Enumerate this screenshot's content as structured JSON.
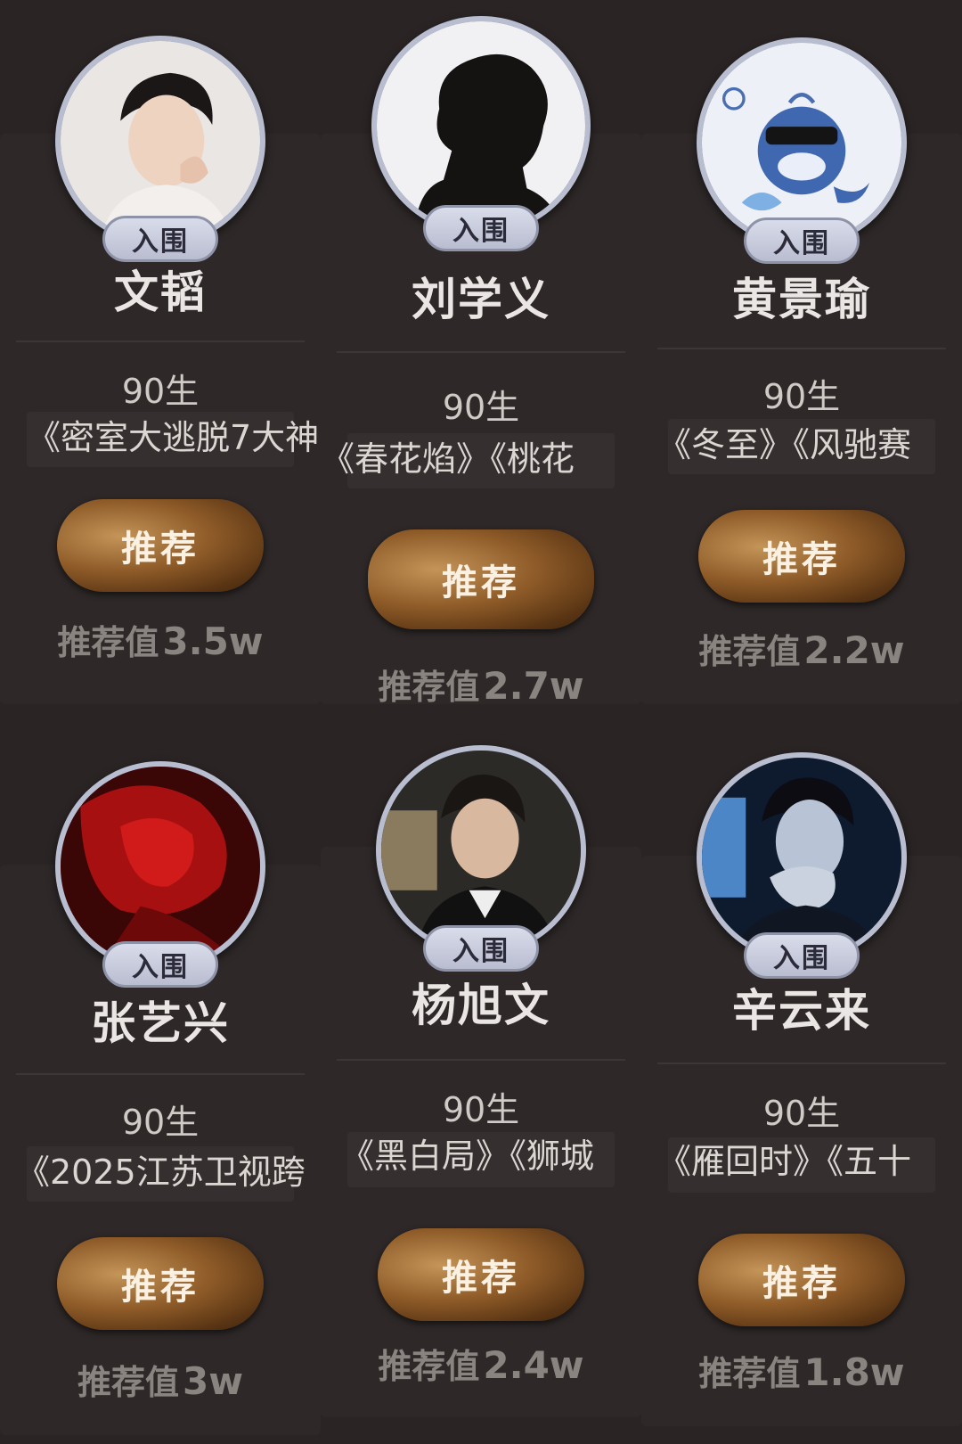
{
  "badge_label": "入围",
  "recommend_label": "推荐",
  "value_prefix": "推荐值",
  "colors": {
    "background": "#2a2424",
    "badge": "#c6cadb",
    "button_gold": "#8e5b28",
    "value_text": "#8a8481"
  },
  "cards": [
    {
      "name": "文韬",
      "age": "90生",
      "works": "《密室大逃脱7大神",
      "value": "3.5w",
      "avatar": "man-portrait-light"
    },
    {
      "name": "刘学义",
      "age": "90生",
      "works": "《春花焰》《桃花",
      "value": "2.7w",
      "avatar": "man-silhouette"
    },
    {
      "name": "黄景瑜",
      "age": "90生",
      "works": "《冬至》《风驰赛",
      "value": "2.2w",
      "avatar": "cartoon-whale"
    },
    {
      "name": "张艺兴",
      "age": "90生",
      "works": "《2025江苏卫视跨",
      "value": "3w",
      "avatar": "red-portrait"
    },
    {
      "name": "杨旭文",
      "age": "90生",
      "works": "《黑白局》《狮城",
      "value": "2.4w",
      "avatar": "man-portrait-suit"
    },
    {
      "name": "辛云来",
      "age": "90生",
      "works": "《雁回时》《五十",
      "value": "1.8w",
      "avatar": "man-portrait-blue"
    }
  ]
}
